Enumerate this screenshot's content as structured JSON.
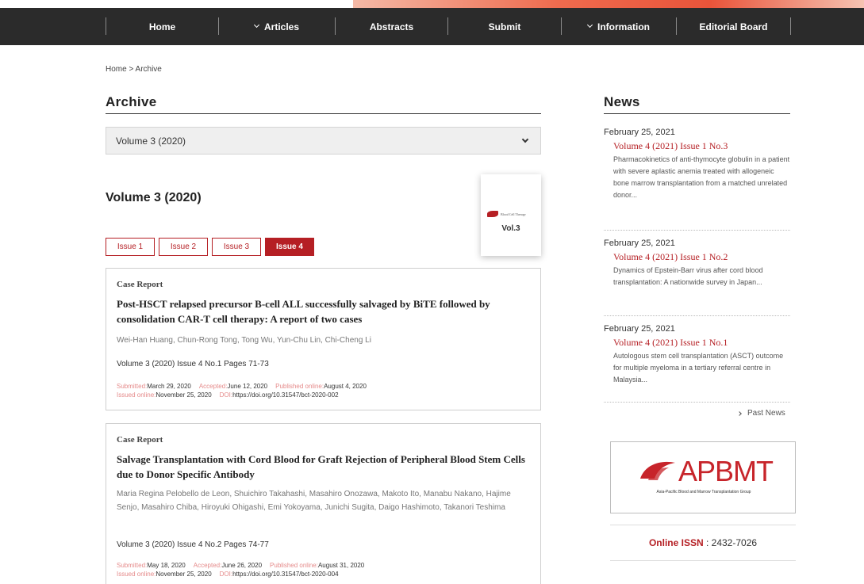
{
  "nav": {
    "items": [
      {
        "label": "Home",
        "has_chevron": false
      },
      {
        "label": "Articles",
        "has_chevron": true
      },
      {
        "label": "Abstracts",
        "has_chevron": false
      },
      {
        "label": "Submit",
        "has_chevron": false
      },
      {
        "label": "Information",
        "has_chevron": true
      },
      {
        "label": "Editorial Board",
        "has_chevron": false
      }
    ]
  },
  "breadcrumb": "Home > Archive",
  "archive": {
    "title": "Archive",
    "selected_volume": "Volume 3 (2020)",
    "volume_heading": "Volume 3 (2020)",
    "cover_label": "Vol.3",
    "cover_logo_text": "Blood Cell Therapy",
    "issues": [
      "Issue 1",
      "Issue 2",
      "Issue 3",
      "Issue 4"
    ],
    "active_issue": "Issue 4",
    "articles": [
      {
        "type": "Case Report",
        "title": "Post-HSCT relapsed precursor B-cell ALL successfully salvaged by BiTE followed by consolidation CAR-T cell therapy: A report of two cases",
        "authors": "Wei-Han Huang, Chun-Rong Tong, Tong Wu, Yun-Chu Lin, Chi-Cheng Li",
        "pages": "Volume 3 (2020) Issue 4 No.1 Pages 71-73",
        "submitted_label": "Submitted:",
        "submitted": "March 29, 2020",
        "accepted_label": "Accepted:",
        "accepted": "June 12, 2020",
        "published_label": "Published online:",
        "published": "August 4, 2020",
        "issued_label": "Issued online:",
        "issued": "November 25, 2020",
        "doi_label": "DOI:",
        "doi": "https://doi.org/10.31547/bct-2020-002"
      },
      {
        "type": "Case Report",
        "title": "Salvage Transplantation with Cord Blood for Graft Rejection of Peripheral Blood Stem Cells due to Donor Specific Antibody",
        "authors": "Maria Regina Pelobello de Leon, Shuichiro Takahashi, Masahiro Onozawa, Makoto Ito, Manabu Nakano, Hajime Senjo, Masahiro Chiba, Hiroyuki Ohigashi, Emi Yokoyama, Junichi Sugita, Daigo Hashimoto, Takanori Teshima",
        "pages": "Volume 3 (2020) Issue 4 No.2 Pages 74-77",
        "submitted_label": "Submitted:",
        "submitted": "May 18, 2020",
        "accepted_label": "Accepted:",
        "accepted": "June 26, 2020",
        "published_label": "Published online:",
        "published": "August 31, 2020",
        "issued_label": "Issued online:",
        "issued": "November 25, 2020",
        "doi_label": "DOI:",
        "doi": "https://doi.org/10.31547/bct-2020-004"
      }
    ]
  },
  "news": {
    "title": "News",
    "items": [
      {
        "date": "February 25, 2021",
        "headline": "Volume 4 (2021) Issue 1 No.3",
        "text": "Pharmacokinetics of anti-thymocyte globulin in a patient with severe aplastic anemia treated with allogeneic bone marrow transplantation from a matched unrelated donor..."
      },
      {
        "date": "February 25, 2021",
        "headline": "Volume 4 (2021) Issue 1 No.2",
        "text": "Dynamics of Epstein-Barr virus after cord blood transplantation: A nationwide survey in Japan..."
      },
      {
        "date": "February 25, 2021",
        "headline": "Volume 4 (2021) Issue 1 No.1",
        "text": "Autologous stem cell transplantation (ASCT) outcome for multiple myeloma in a tertiary referral centre in Malaysia..."
      }
    ],
    "past_news_label": "Past News"
  },
  "banner": {
    "name": "APBMT",
    "subtitle": "Asia-Pacific Blood and Marrow Transplantation Group"
  },
  "issn": {
    "label": "Online ISSN",
    "separator": " : ",
    "value": "2432-7026"
  },
  "colors": {
    "brand_red": "#b51f24",
    "nav_bg": "#2b2b2b",
    "meta_label": "#e58a8a"
  }
}
